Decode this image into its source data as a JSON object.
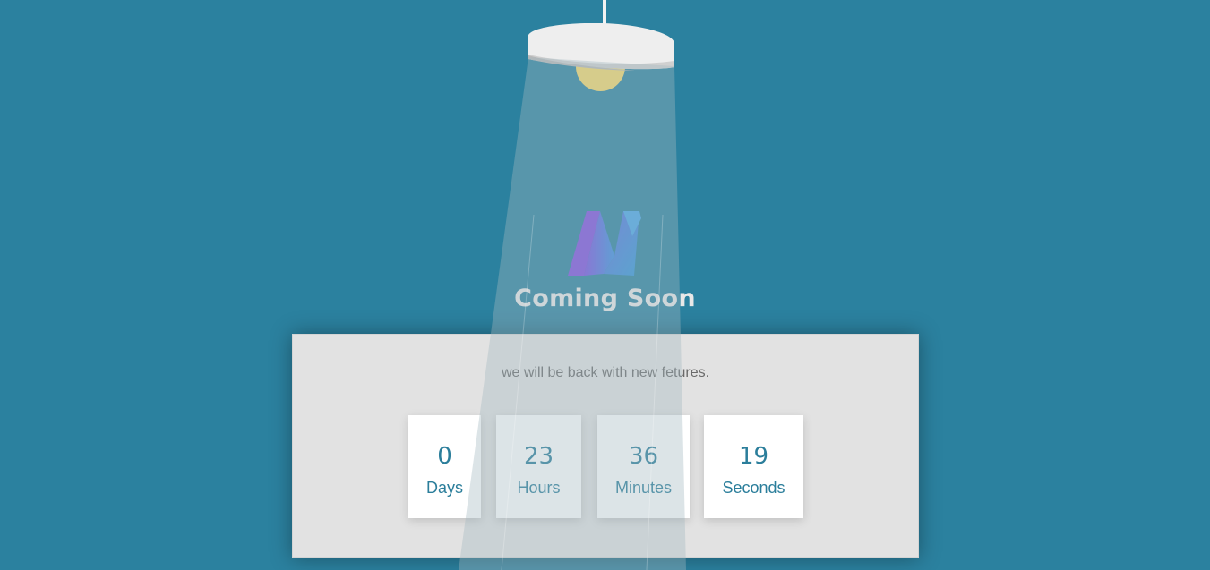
{
  "page": {
    "title": "Coming Soon",
    "message": "we will be back with new fetures."
  },
  "countdown": [
    {
      "value": "0",
      "label": "Days"
    },
    {
      "value": "23",
      "label": "Hours"
    },
    {
      "value": "36",
      "label": "Minutes"
    },
    {
      "value": "19",
      "label": "Seconds"
    }
  ],
  "colors": {
    "background": "#2b819f",
    "card": "#e2e2e2",
    "accent": "#2b7e9b",
    "bulb": "#f6d86b"
  },
  "icons": {
    "lamp": "lamp-icon",
    "logo": "brand-logo"
  }
}
